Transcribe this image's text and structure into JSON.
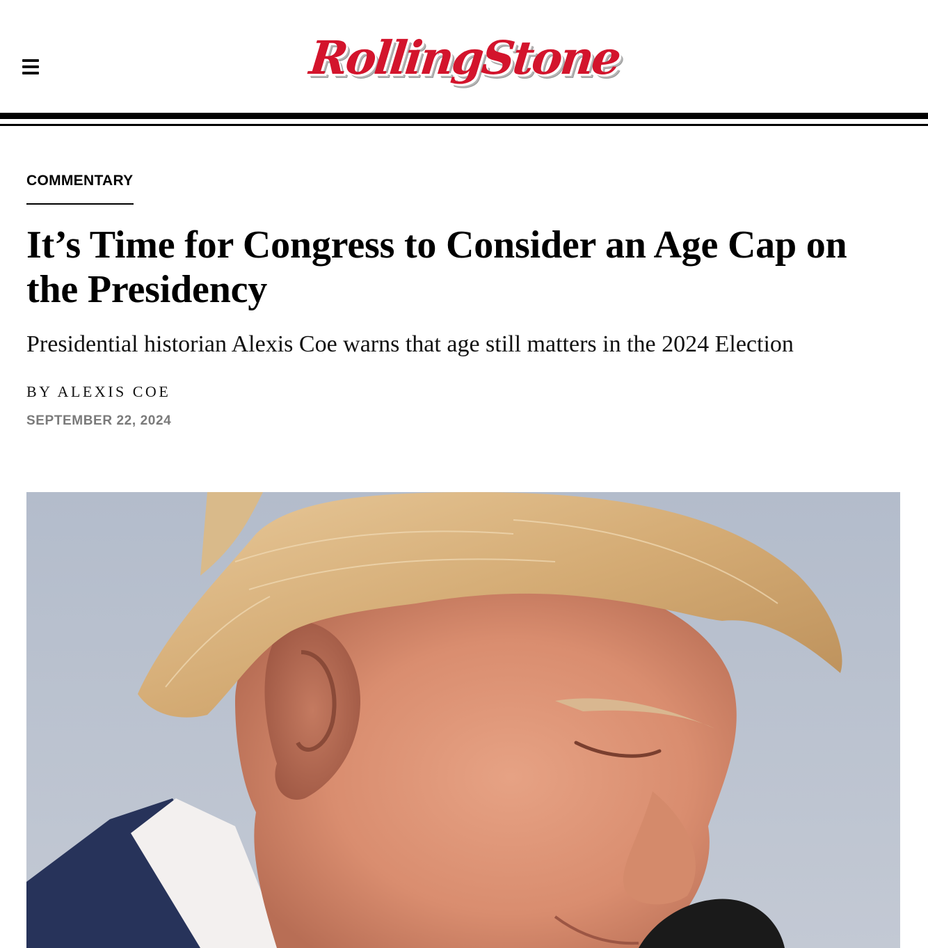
{
  "header": {
    "logo_text": "RollingStone",
    "logo_color": "#d3142c"
  },
  "article": {
    "category": "COMMENTARY",
    "headline": "It’s Time for Congress to Consider an Age Cap on the Presidency",
    "dek": "Presidential historian Alexis Coe warns that age still matters in the 2024 Election",
    "byline_prefix": "BY",
    "author": "ALEXIS COE",
    "date": "SEPTEMBER 22, 2024"
  },
  "hero_image": {
    "subject": "close-up-portrait-photo"
  },
  "icons": {
    "menu": "hamburger-menu-icon"
  }
}
